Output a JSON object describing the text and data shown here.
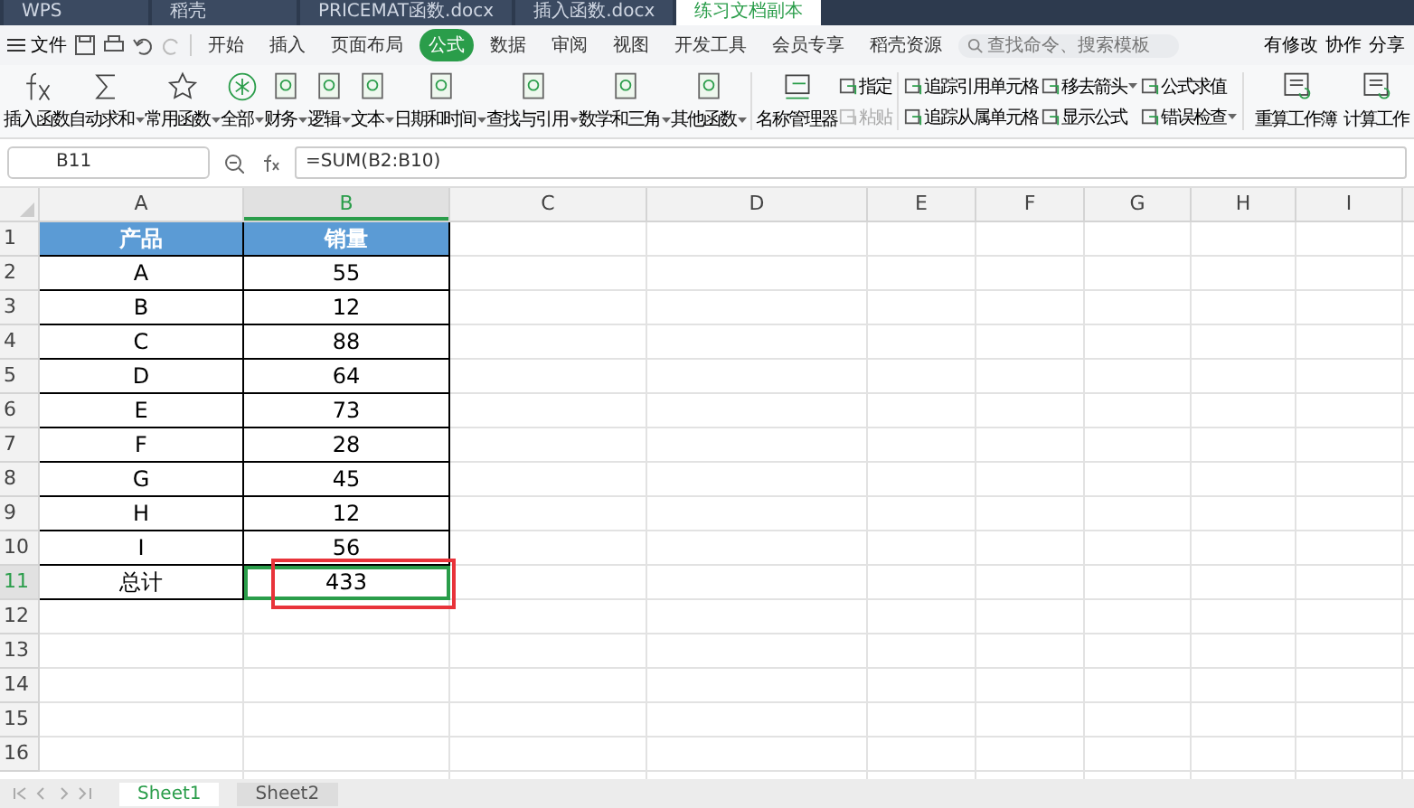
{
  "window_tabs": [
    {
      "label": "WPS",
      "selected": false
    },
    {
      "label": "稻壳",
      "selected": false
    },
    {
      "label": "PRICEMAT函数.docx",
      "selected": false
    },
    {
      "label": "插入函数.docx",
      "selected": false
    },
    {
      "label": "练习文档副本",
      "selected": true
    }
  ],
  "menu": {
    "file": "文件",
    "tabs": [
      {
        "label": "开始",
        "selected": false
      },
      {
        "label": "插入",
        "selected": false
      },
      {
        "label": "页面布局",
        "selected": false
      },
      {
        "label": "公式",
        "selected": true
      },
      {
        "label": "数据",
        "selected": false
      },
      {
        "label": "审阅",
        "selected": false
      },
      {
        "label": "视图",
        "selected": false
      },
      {
        "label": "开发工具",
        "selected": false
      },
      {
        "label": "会员专享",
        "selected": false
      },
      {
        "label": "稻壳资源",
        "selected": false
      }
    ],
    "search": {
      "placeholder": "查找命令、搜索模板"
    },
    "actions": [
      "有修改",
      "协作",
      "分享"
    ]
  },
  "ribbon": {
    "large": [
      {
        "label": "插入函数",
        "dropdown": false
      },
      {
        "label": "自动求和",
        "dropdown": true
      },
      {
        "label": "常用函数",
        "dropdown": true
      },
      {
        "label": "全部",
        "dropdown": true
      },
      {
        "label": "财务",
        "dropdown": true
      },
      {
        "label": "逻辑",
        "dropdown": true
      },
      {
        "label": "文本",
        "dropdown": true
      },
      {
        "label": "日期和时间",
        "dropdown": true
      },
      {
        "label": "查找与引用",
        "dropdown": true
      },
      {
        "label": "数学和三角",
        "dropdown": true
      },
      {
        "label": "其他函数",
        "dropdown": true
      },
      {
        "label": "名称管理器",
        "dropdown": false
      }
    ],
    "small": [
      [
        {
          "label": "指定",
          "disabled": false,
          "dropdown": false
        },
        {
          "label": "粘贴",
          "disabled": true,
          "dropdown": false
        }
      ],
      [
        {
          "label": "追踪引用单元格",
          "disabled": false,
          "dropdown": false
        },
        {
          "label": "追踪从属单元格",
          "disabled": false,
          "dropdown": false
        }
      ],
      [
        {
          "label": "移去箭头",
          "disabled": false,
          "dropdown": true
        },
        {
          "label": "显示公式",
          "disabled": false,
          "dropdown": false
        }
      ],
      [
        {
          "label": "公式求值",
          "disabled": false,
          "dropdown": false
        },
        {
          "label": "错误检查",
          "disabled": false,
          "dropdown": true
        }
      ]
    ],
    "right": [
      {
        "label": "重算工作簿"
      },
      {
        "label": "计算工作"
      }
    ]
  },
  "formula_bar": {
    "cell_ref": "B11",
    "formula": "=SUM(B2:B10)"
  },
  "sheet": {
    "highlight_box": true,
    "columns": [
      {
        "label": "A",
        "selected": false
      },
      {
        "label": "B",
        "selected": true
      },
      {
        "label": "C",
        "selected": false
      },
      {
        "label": "D",
        "selected": false
      },
      {
        "label": "E",
        "selected": false
      },
      {
        "label": "F",
        "selected": false
      },
      {
        "label": "G",
        "selected": false
      },
      {
        "label": "H",
        "selected": false
      },
      {
        "label": "I",
        "selected": false
      }
    ],
    "rows": [
      {
        "number": "1",
        "kind": "header",
        "selected": false,
        "cells": [
          "产品",
          "销量"
        ]
      },
      {
        "number": "2",
        "kind": "data",
        "selected": false,
        "cells": [
          "A",
          "55"
        ]
      },
      {
        "number": "3",
        "kind": "data",
        "selected": false,
        "cells": [
          "B",
          "12"
        ]
      },
      {
        "number": "4",
        "kind": "data",
        "selected": false,
        "cells": [
          "C",
          "88"
        ]
      },
      {
        "number": "5",
        "kind": "data",
        "selected": false,
        "cells": [
          "D",
          "64"
        ]
      },
      {
        "number": "6",
        "kind": "data",
        "selected": false,
        "cells": [
          "E",
          "73"
        ]
      },
      {
        "number": "7",
        "kind": "data",
        "selected": false,
        "cells": [
          "F",
          "28"
        ]
      },
      {
        "number": "8",
        "kind": "data",
        "selected": false,
        "cells": [
          "G",
          "45"
        ]
      },
      {
        "number": "9",
        "kind": "data",
        "selected": false,
        "cells": [
          "H",
          "12"
        ]
      },
      {
        "number": "10",
        "kind": "data",
        "selected": false,
        "cells": [
          "I",
          "56"
        ]
      },
      {
        "number": "11",
        "kind": "data",
        "selected": true,
        "cells": [
          "总计",
          "433"
        ]
      },
      {
        "number": "12",
        "kind": "empty",
        "selected": false
      },
      {
        "number": "13",
        "kind": "empty",
        "selected": false
      },
      {
        "number": "14",
        "kind": "empty",
        "selected": false
      },
      {
        "number": "15",
        "kind": "empty",
        "selected": false
      },
      {
        "number": "16",
        "kind": "empty",
        "selected": false
      }
    ]
  },
  "sheet_tabs": [
    {
      "label": "Sheet1",
      "selected": true
    },
    {
      "label": "Sheet2",
      "selected": false
    }
  ]
}
